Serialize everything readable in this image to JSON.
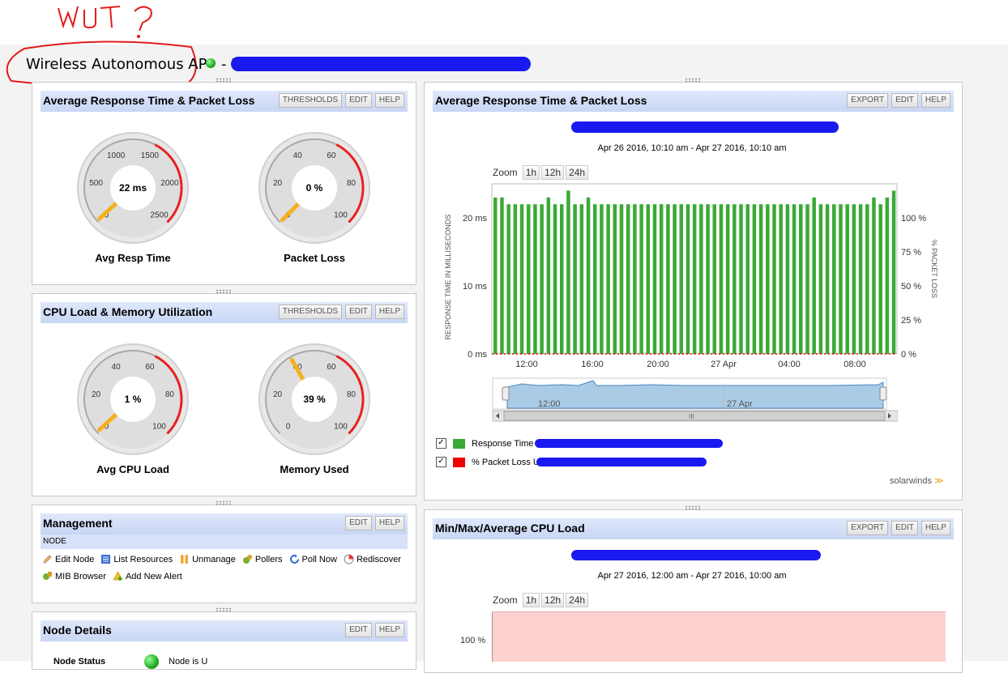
{
  "annotation": {
    "text": "WUT?"
  },
  "page": {
    "title": "Wireless Autonomous AP",
    "title_suffix": " - U"
  },
  "colors": {
    "header_gradient": "#c8d6f5",
    "response_bar": "#3aaa35",
    "loss_legend": "#ee0000",
    "gauge_needle": "#f5b01c",
    "gauge_red": "#e82020"
  },
  "panel_resp": {
    "title": "Average Response Time & Packet Loss",
    "buttons": [
      "THRESHOLDS",
      "EDIT",
      "HELP"
    ],
    "gauge1": {
      "value_text": "22 ms",
      "label": "Avg Resp Time",
      "ticks": [
        "0",
        "500",
        "1000",
        "1500",
        "2000",
        "2500"
      ],
      "value": 22,
      "max": 2500
    },
    "gauge2": {
      "value_text": "0 %",
      "label": "Packet Loss",
      "ticks": [
        "0",
        "20",
        "40",
        "60",
        "80",
        "100"
      ],
      "value": 0,
      "max": 100
    }
  },
  "panel_cpu": {
    "title": "CPU Load & Memory Utilization",
    "buttons": [
      "THRESHOLDS",
      "EDIT",
      "HELP"
    ],
    "gauge1": {
      "value_text": "1 %",
      "label": "Avg CPU Load",
      "ticks": [
        "0",
        "20",
        "40",
        "60",
        "80",
        "100"
      ],
      "value": 1,
      "max": 100
    },
    "gauge2": {
      "value_text": "39 %",
      "label": "Memory Used",
      "ticks": [
        "0",
        "20",
        "40",
        "60",
        "80",
        "100"
      ],
      "value": 39,
      "max": 100
    }
  },
  "panel_mgmt": {
    "title": "Management",
    "buttons": [
      "EDIT",
      "HELP"
    ],
    "subhead": "NODE",
    "actions": [
      {
        "label": "Edit Node",
        "icon": "pencil-icon"
      },
      {
        "label": "List Resources",
        "icon": "list-icon"
      },
      {
        "label": "Unmanage",
        "icon": "pause-icon"
      },
      {
        "label": "Pollers",
        "icon": "gears-icon"
      },
      {
        "label": "Poll Now",
        "icon": "refresh-icon"
      },
      {
        "label": "Rediscover",
        "icon": "radar-icon"
      },
      {
        "label": "MIB Browser",
        "icon": "mib-browser-icon"
      },
      {
        "label": "Add New Alert",
        "icon": "add-alert-icon"
      }
    ]
  },
  "panel_node": {
    "title": "Node Details",
    "buttons": [
      "EDIT",
      "HELP"
    ],
    "row_label": "Node Status",
    "row_value": "Node is U"
  },
  "panel_chart": {
    "title": "Average Response Time & Packet Loss",
    "buttons": [
      "EXPORT",
      "EDIT",
      "HELP"
    ],
    "date_range": "Apr 26 2016, 10:10 am - Apr 27 2016, 10:10 am",
    "zoom_label": "Zoom",
    "zoom_buttons": [
      "1h",
      "12h",
      "24h"
    ],
    "navigator_labels": [
      "12:00",
      "27 Apr"
    ],
    "scroll_grip": "III",
    "legend": [
      {
        "checked": "✓",
        "label": "Response Time U",
        "color": "#3aaa35"
      },
      {
        "checked": "✓",
        "label": "% Packet Loss U",
        "color": "#ee0000"
      }
    ],
    "brand": "solarwinds"
  },
  "panel_cpu_chart": {
    "title": "Min/Max/Average CPU Load",
    "buttons": [
      "EXPORT",
      "EDIT",
      "HELP"
    ],
    "date_range": "Apr 27 2016, 12:00 am - Apr 27 2016, 10:00 am",
    "zoom_label": "Zoom",
    "zoom_buttons": [
      "1h",
      "12h",
      "24h"
    ],
    "y_tick": "100 %"
  },
  "chart_data": [
    {
      "type": "bar",
      "title": "",
      "ylabel": "RESPONSE TIME IN MILLISECONDS",
      "y2label": "% PACKET LOSS",
      "yticks": [
        "0 ms",
        "10 ms",
        "20 ms"
      ],
      "y2ticks": [
        "0 %",
        "25 %",
        "50 %",
        "75 %",
        "100 %"
      ],
      "xticks": [
        "12:00",
        "16:00",
        "20:00",
        "27 Apr",
        "04:00",
        "08:00"
      ],
      "ylim": [
        0,
        25
      ],
      "y2lim": [
        0,
        100
      ],
      "grid": false,
      "series": [
        {
          "name": "Response Time",
          "color": "#3aaa35",
          "values": [
            23,
            23,
            22,
            22,
            22,
            22,
            22,
            22,
            23,
            22,
            22,
            24,
            22,
            22,
            23,
            22,
            22,
            22,
            22,
            22,
            22,
            22,
            22,
            22,
            22,
            22,
            22,
            22,
            22,
            22,
            22,
            22,
            22,
            22,
            22,
            22,
            22,
            22,
            22,
            22,
            22,
            22,
            22,
            22,
            22,
            22,
            22,
            22,
            23,
            22,
            22,
            22,
            22,
            22,
            22,
            22,
            22,
            23,
            22,
            23,
            24
          ]
        },
        {
          "name": "% Packet Loss",
          "color": "#ee0000",
          "values": [
            0
          ]
        }
      ]
    },
    {
      "type": "area",
      "title": "",
      "yticks": [
        "100 %"
      ],
      "series": []
    }
  ]
}
